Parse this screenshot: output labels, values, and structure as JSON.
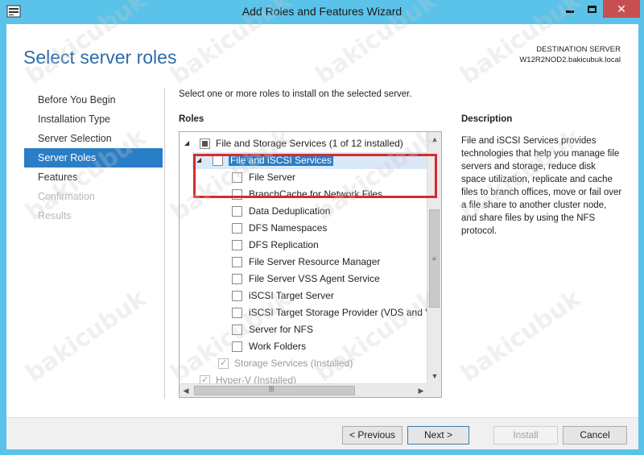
{
  "window": {
    "title": "Add Roles and Features Wizard",
    "close_glyph": "✕"
  },
  "header": {
    "page_title": "Select server roles",
    "destination_label": "DESTINATION SERVER",
    "destination_value": "W12R2NOD2.bakicubuk.local"
  },
  "nav": {
    "items": [
      {
        "label": "Before You Begin",
        "state": "normal"
      },
      {
        "label": "Installation Type",
        "state": "normal"
      },
      {
        "label": "Server Selection",
        "state": "normal"
      },
      {
        "label": "Server Roles",
        "state": "active"
      },
      {
        "label": "Features",
        "state": "normal"
      },
      {
        "label": "Confirmation",
        "state": "disabled"
      },
      {
        "label": "Results",
        "state": "disabled"
      }
    ]
  },
  "main": {
    "intro": "Select one or more roles to install on the selected server.",
    "roles_label": "Roles",
    "description_label": "Description",
    "description_text": "File and iSCSI Services provides technologies that help you manage file servers and storage, reduce disk space utilization, replicate and cache files to branch offices, move or fail over a file share to another cluster node, and share files by using the NFS protocol.",
    "tree": [
      {
        "label": "File and Storage Services (1 of 12 installed)",
        "level": 0,
        "checkbox": "partial",
        "expander": "◢"
      },
      {
        "label": "File and iSCSI Services",
        "level": 1,
        "checkbox": "unchecked",
        "expander": "◢",
        "selected": true
      },
      {
        "label": "File Server",
        "level": 2,
        "checkbox": "unchecked"
      },
      {
        "label": "BranchCache for Network Files",
        "level": 2,
        "checkbox": "unchecked"
      },
      {
        "label": "Data Deduplication",
        "level": 2,
        "checkbox": "unchecked"
      },
      {
        "label": "DFS Namespaces",
        "level": 2,
        "checkbox": "unchecked"
      },
      {
        "label": "DFS Replication",
        "level": 2,
        "checkbox": "unchecked"
      },
      {
        "label": "File Server Resource Manager",
        "level": 2,
        "checkbox": "unchecked"
      },
      {
        "label": "File Server VSS Agent Service",
        "level": 2,
        "checkbox": "unchecked"
      },
      {
        "label": "iSCSI Target Server",
        "level": 2,
        "checkbox": "unchecked"
      },
      {
        "label": "iSCSI Target Storage Provider (VDS and VSS",
        "level": 2,
        "checkbox": "unchecked"
      },
      {
        "label": "Server for NFS",
        "level": 2,
        "checkbox": "unchecked"
      },
      {
        "label": "Work Folders",
        "level": 2,
        "checkbox": "unchecked"
      },
      {
        "label": "Storage Services (Installed)",
        "level": 1,
        "checkbox": "checked-disabled"
      },
      {
        "label": "Hyper-V (Installed)",
        "level": 0,
        "checkbox": "checked-disabled"
      }
    ],
    "vscroll_glyphs": {
      "up": "▲",
      "down": "▼",
      "grip": "≡"
    },
    "hscroll_glyphs": {
      "left": "◀",
      "right": "▶",
      "grip": "|||"
    }
  },
  "footer": {
    "previous": "< Previous",
    "next": "Next >",
    "install": "Install",
    "cancel": "Cancel"
  },
  "watermark": "bakicubuk",
  "colors": {
    "frame": "#5bc3ea",
    "accent": "#2a7ec5",
    "title_blue": "#2e6ba8",
    "highlight_red": "#d62b2b",
    "close_red": "#c74f50"
  }
}
